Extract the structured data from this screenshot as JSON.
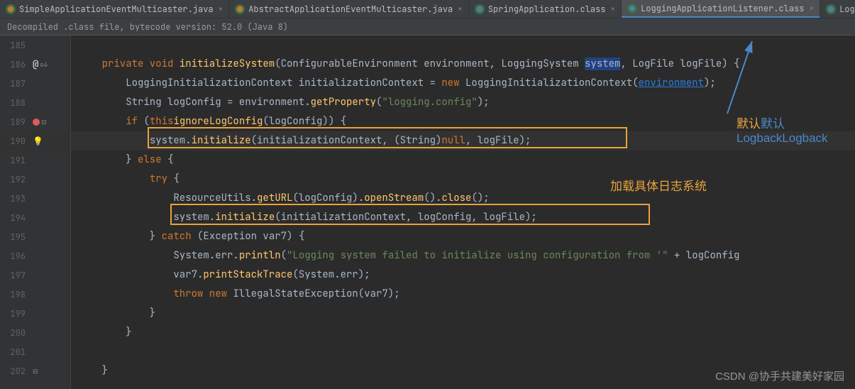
{
  "tabs": [
    {
      "label": "SimpleApplicationEventMulticaster.java",
      "icon": "java",
      "active": false
    },
    {
      "label": "AbstractApplicationEventMulticaster.java",
      "icon": "java",
      "active": false
    },
    {
      "label": "SpringApplication.class",
      "icon": "class",
      "active": false
    },
    {
      "label": "LoggingApplicationListener.class",
      "icon": "class",
      "active": true
    },
    {
      "label": "LogbackLoggingSystem.class",
      "icon": "class",
      "active": false
    }
  ],
  "banner": "Decompiled .class file, bytecode version: 52.0 (Java 8)",
  "lines": [
    "185",
    "186",
    "187",
    "188",
    "189",
    "190",
    "191",
    "192",
    "193",
    "194",
    "195",
    "196",
    "197",
    "198",
    "199",
    "200",
    "201",
    "202"
  ],
  "code": {
    "l186": {
      "pre": "    ",
      "kw1": "private void ",
      "m": "initializeSystem",
      "sig1": "(ConfigurableEnvironment ",
      "p1": "environment",
      "sig2": ", LoggingSystem ",
      "p2": "system",
      "sig3": ", LogFile ",
      "p3": "logFile",
      "sig4": ") {"
    },
    "l187": {
      "pre": "        ",
      "t": "LoggingInitializationContext initializationContext = ",
      "kw": "new ",
      "ty": "LoggingInitializationContext",
      "op": "(",
      "lk": "environment",
      "cl": ");"
    },
    "l188": {
      "pre": "        ",
      "t": "String logConfig = environment.",
      "m": "getProperty",
      "op": "(",
      "s": "\"logging.config\"",
      "cl": ");"
    },
    "l189": {
      "pre": "        ",
      "kw1": "if ",
      "op": "(",
      "kw2": "this",
      ".": ".",
      "m": "ignoreLogConfig",
      "sig": "(logConfig)) {"
    },
    "l190": {
      "pre": "            ",
      "v": "system",
      "op": ".",
      "m": "initialize",
      "sig": "(initializationContext, (String)",
      "kw": "null",
      "cl": ", logFile);"
    },
    "l191": {
      "pre": "        } ",
      "kw": "else ",
      "op": "{"
    },
    "l192": {
      "pre": "            ",
      "kw": "try ",
      "op": "{"
    },
    "l193": {
      "pre": "                ",
      "t": "ResourceUtils.",
      "m": "getURL",
      "sig": "(logConfig).",
      "m2": "openStream",
      "sig2": "().",
      "m3": "close",
      "sig3": "();"
    },
    "l194": {
      "pre": "                ",
      "v": "system.",
      "m": "initialize",
      "sig": "(initializationContext, logConfig, logFile);"
    },
    "l195": {
      "pre": "            } ",
      "kw": "catch ",
      "sig": "(Exception var7) {"
    },
    "l196": {
      "pre": "                ",
      "t": "System.err.",
      "m": "println",
      "op": "(",
      "s": "\"Logging system failed to initialize using configuration from '\"",
      "cl": " + logConfig"
    },
    "l197": {
      "pre": "                ",
      "t": "var7.",
      "m": "printStackTrace",
      "sig": "(System.err);"
    },
    "l198": {
      "pre": "                ",
      "kw1": "throw new ",
      "t": "IllegalStateException(var7);"
    },
    "l199": "            }",
    "l200": "        }",
    "l201": "",
    "l202": "    }"
  },
  "annotations": {
    "a1": "默认Logback",
    "a2": "加载具体日志系统"
  },
  "watermark": "CSDN @协手共建美好家园"
}
